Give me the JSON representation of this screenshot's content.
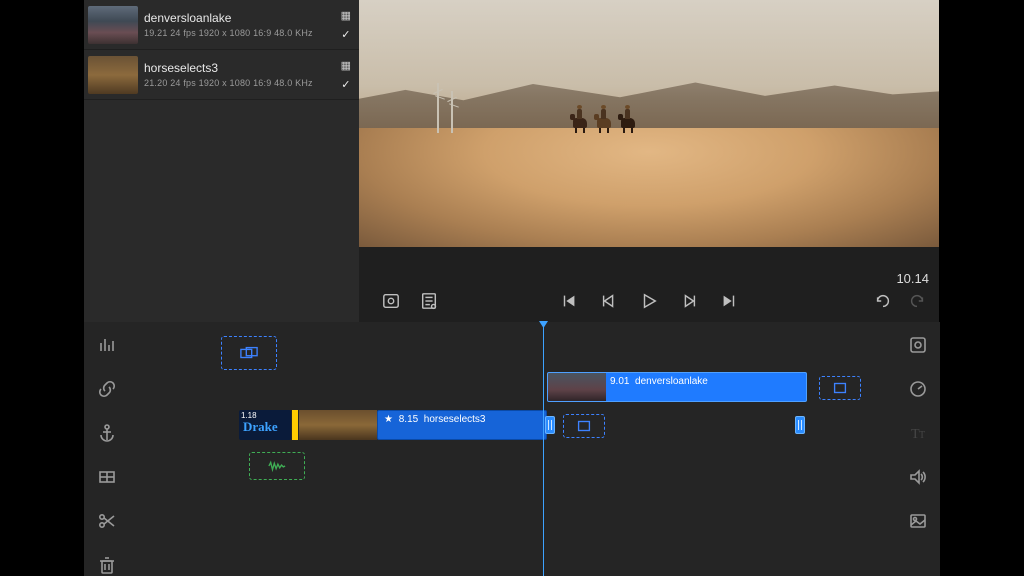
{
  "library": {
    "clips": [
      {
        "title": "denversloanlake",
        "meta": "19.21  24 fps  1920 x 1080  16:9  48.0 KHz"
      },
      {
        "title": "horseselects3",
        "meta": "21.20  24 fps  1920 x 1080  16:9  48.0 KHz"
      }
    ]
  },
  "preview": {
    "timecode": "10.14"
  },
  "timeline": {
    "title_clip": {
      "badge": "1.18",
      "text": "Drake"
    },
    "clip_horse": {
      "time": "8.15",
      "name": "horseselects3"
    },
    "clip_lake": {
      "time": "9.01",
      "name": "denversloanlake"
    }
  }
}
